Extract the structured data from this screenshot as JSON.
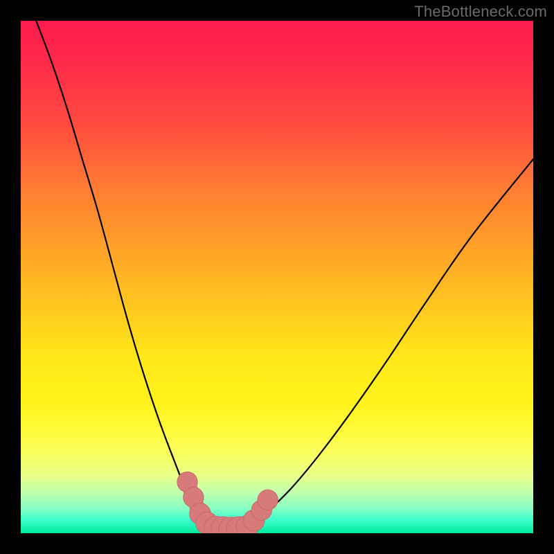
{
  "watermark": "TheBottleneck.com",
  "colors": {
    "frame": "#000000",
    "curve": "#000000",
    "marker_fill": "#d77a7a",
    "marker_stroke": "#c96a6a",
    "gradient_top": "#ff1a4d",
    "gradient_bottom": "#00e89a"
  },
  "chart_data": {
    "type": "line",
    "title": "",
    "xlabel": "",
    "ylabel": "",
    "xlim": [
      0,
      100
    ],
    "ylim": [
      0,
      100
    ],
    "grid": false,
    "series": [
      {
        "name": "left_curve",
        "x": [
          3,
          6,
          9,
          12,
          15,
          18,
          21,
          24,
          27,
          30,
          32,
          33.5,
          35,
          36.5,
          38
        ],
        "y": [
          100,
          92,
          83,
          73,
          63,
          52,
          41,
          31,
          22,
          14,
          9,
          6,
          3.5,
          1.8,
          1
        ]
      },
      {
        "name": "right_curve",
        "x": [
          44,
          46,
          49,
          53,
          58,
          64,
          71,
          79,
          88,
          100
        ],
        "y": [
          1,
          2.5,
          5,
          9,
          15,
          23,
          33,
          45,
          58,
          73
        ]
      }
    ],
    "markers": [
      {
        "series": "left",
        "x": 32.5,
        "y": 10,
        "r": 1.6
      },
      {
        "series": "left",
        "x": 33.7,
        "y": 7,
        "r": 1.6
      },
      {
        "series": "left",
        "x": 35.0,
        "y": 3.8,
        "r": 1.7
      },
      {
        "series": "left",
        "x": 36.3,
        "y": 2.0,
        "r": 1.8
      },
      {
        "series": "left",
        "x": 38.0,
        "y": 1.1,
        "r": 1.9
      },
      {
        "series": "valley",
        "x": 39.5,
        "y": 0.9,
        "r": 2.0
      },
      {
        "series": "valley",
        "x": 41.0,
        "y": 0.8,
        "r": 2.0
      },
      {
        "series": "valley",
        "x": 42.5,
        "y": 0.9,
        "r": 2.0
      },
      {
        "series": "right",
        "x": 44.2,
        "y": 1.3,
        "r": 1.8
      },
      {
        "series": "right",
        "x": 45.5,
        "y": 2.5,
        "r": 1.7
      },
      {
        "series": "right",
        "x": 47.0,
        "y": 4.5,
        "r": 1.6
      },
      {
        "series": "right",
        "x": 48.2,
        "y": 6.5,
        "r": 1.6
      }
    ]
  }
}
